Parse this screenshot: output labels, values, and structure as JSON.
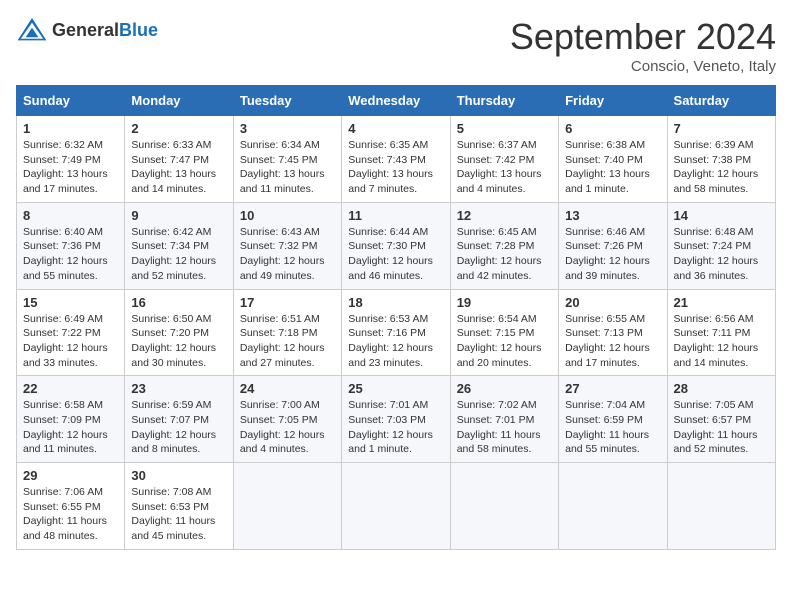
{
  "logo": {
    "general": "General",
    "blue": "Blue"
  },
  "title": "September 2024",
  "subtitle": "Conscio, Veneto, Italy",
  "days": [
    "Sunday",
    "Monday",
    "Tuesday",
    "Wednesday",
    "Thursday",
    "Friday",
    "Saturday"
  ],
  "weeks": [
    [
      {
        "day": 1,
        "lines": [
          "Sunrise: 6:32 AM",
          "Sunset: 7:49 PM",
          "Daylight: 13 hours",
          "and 17 minutes."
        ]
      },
      {
        "day": 2,
        "lines": [
          "Sunrise: 6:33 AM",
          "Sunset: 7:47 PM",
          "Daylight: 13 hours",
          "and 14 minutes."
        ]
      },
      {
        "day": 3,
        "lines": [
          "Sunrise: 6:34 AM",
          "Sunset: 7:45 PM",
          "Daylight: 13 hours",
          "and 11 minutes."
        ]
      },
      {
        "day": 4,
        "lines": [
          "Sunrise: 6:35 AM",
          "Sunset: 7:43 PM",
          "Daylight: 13 hours",
          "and 7 minutes."
        ]
      },
      {
        "day": 5,
        "lines": [
          "Sunrise: 6:37 AM",
          "Sunset: 7:42 PM",
          "Daylight: 13 hours",
          "and 4 minutes."
        ]
      },
      {
        "day": 6,
        "lines": [
          "Sunrise: 6:38 AM",
          "Sunset: 7:40 PM",
          "Daylight: 13 hours",
          "and 1 minute."
        ]
      },
      {
        "day": 7,
        "lines": [
          "Sunrise: 6:39 AM",
          "Sunset: 7:38 PM",
          "Daylight: 12 hours",
          "and 58 minutes."
        ]
      }
    ],
    [
      {
        "day": 8,
        "lines": [
          "Sunrise: 6:40 AM",
          "Sunset: 7:36 PM",
          "Daylight: 12 hours",
          "and 55 minutes."
        ]
      },
      {
        "day": 9,
        "lines": [
          "Sunrise: 6:42 AM",
          "Sunset: 7:34 PM",
          "Daylight: 12 hours",
          "and 52 minutes."
        ]
      },
      {
        "day": 10,
        "lines": [
          "Sunrise: 6:43 AM",
          "Sunset: 7:32 PM",
          "Daylight: 12 hours",
          "and 49 minutes."
        ]
      },
      {
        "day": 11,
        "lines": [
          "Sunrise: 6:44 AM",
          "Sunset: 7:30 PM",
          "Daylight: 12 hours",
          "and 46 minutes."
        ]
      },
      {
        "day": 12,
        "lines": [
          "Sunrise: 6:45 AM",
          "Sunset: 7:28 PM",
          "Daylight: 12 hours",
          "and 42 minutes."
        ]
      },
      {
        "day": 13,
        "lines": [
          "Sunrise: 6:46 AM",
          "Sunset: 7:26 PM",
          "Daylight: 12 hours",
          "and 39 minutes."
        ]
      },
      {
        "day": 14,
        "lines": [
          "Sunrise: 6:48 AM",
          "Sunset: 7:24 PM",
          "Daylight: 12 hours",
          "and 36 minutes."
        ]
      }
    ],
    [
      {
        "day": 15,
        "lines": [
          "Sunrise: 6:49 AM",
          "Sunset: 7:22 PM",
          "Daylight: 12 hours",
          "and 33 minutes."
        ]
      },
      {
        "day": 16,
        "lines": [
          "Sunrise: 6:50 AM",
          "Sunset: 7:20 PM",
          "Daylight: 12 hours",
          "and 30 minutes."
        ]
      },
      {
        "day": 17,
        "lines": [
          "Sunrise: 6:51 AM",
          "Sunset: 7:18 PM",
          "Daylight: 12 hours",
          "and 27 minutes."
        ]
      },
      {
        "day": 18,
        "lines": [
          "Sunrise: 6:53 AM",
          "Sunset: 7:16 PM",
          "Daylight: 12 hours",
          "and 23 minutes."
        ]
      },
      {
        "day": 19,
        "lines": [
          "Sunrise: 6:54 AM",
          "Sunset: 7:15 PM",
          "Daylight: 12 hours",
          "and 20 minutes."
        ]
      },
      {
        "day": 20,
        "lines": [
          "Sunrise: 6:55 AM",
          "Sunset: 7:13 PM",
          "Daylight: 12 hours",
          "and 17 minutes."
        ]
      },
      {
        "day": 21,
        "lines": [
          "Sunrise: 6:56 AM",
          "Sunset: 7:11 PM",
          "Daylight: 12 hours",
          "and 14 minutes."
        ]
      }
    ],
    [
      {
        "day": 22,
        "lines": [
          "Sunrise: 6:58 AM",
          "Sunset: 7:09 PM",
          "Daylight: 12 hours",
          "and 11 minutes."
        ]
      },
      {
        "day": 23,
        "lines": [
          "Sunrise: 6:59 AM",
          "Sunset: 7:07 PM",
          "Daylight: 12 hours",
          "and 8 minutes."
        ]
      },
      {
        "day": 24,
        "lines": [
          "Sunrise: 7:00 AM",
          "Sunset: 7:05 PM",
          "Daylight: 12 hours",
          "and 4 minutes."
        ]
      },
      {
        "day": 25,
        "lines": [
          "Sunrise: 7:01 AM",
          "Sunset: 7:03 PM",
          "Daylight: 12 hours",
          "and 1 minute."
        ]
      },
      {
        "day": 26,
        "lines": [
          "Sunrise: 7:02 AM",
          "Sunset: 7:01 PM",
          "Daylight: 11 hours",
          "and 58 minutes."
        ]
      },
      {
        "day": 27,
        "lines": [
          "Sunrise: 7:04 AM",
          "Sunset: 6:59 PM",
          "Daylight: 11 hours",
          "and 55 minutes."
        ]
      },
      {
        "day": 28,
        "lines": [
          "Sunrise: 7:05 AM",
          "Sunset: 6:57 PM",
          "Daylight: 11 hours",
          "and 52 minutes."
        ]
      }
    ],
    [
      {
        "day": 29,
        "lines": [
          "Sunrise: 7:06 AM",
          "Sunset: 6:55 PM",
          "Daylight: 11 hours",
          "and 48 minutes."
        ]
      },
      {
        "day": 30,
        "lines": [
          "Sunrise: 7:08 AM",
          "Sunset: 6:53 PM",
          "Daylight: 11 hours",
          "and 45 minutes."
        ]
      },
      null,
      null,
      null,
      null,
      null
    ]
  ]
}
